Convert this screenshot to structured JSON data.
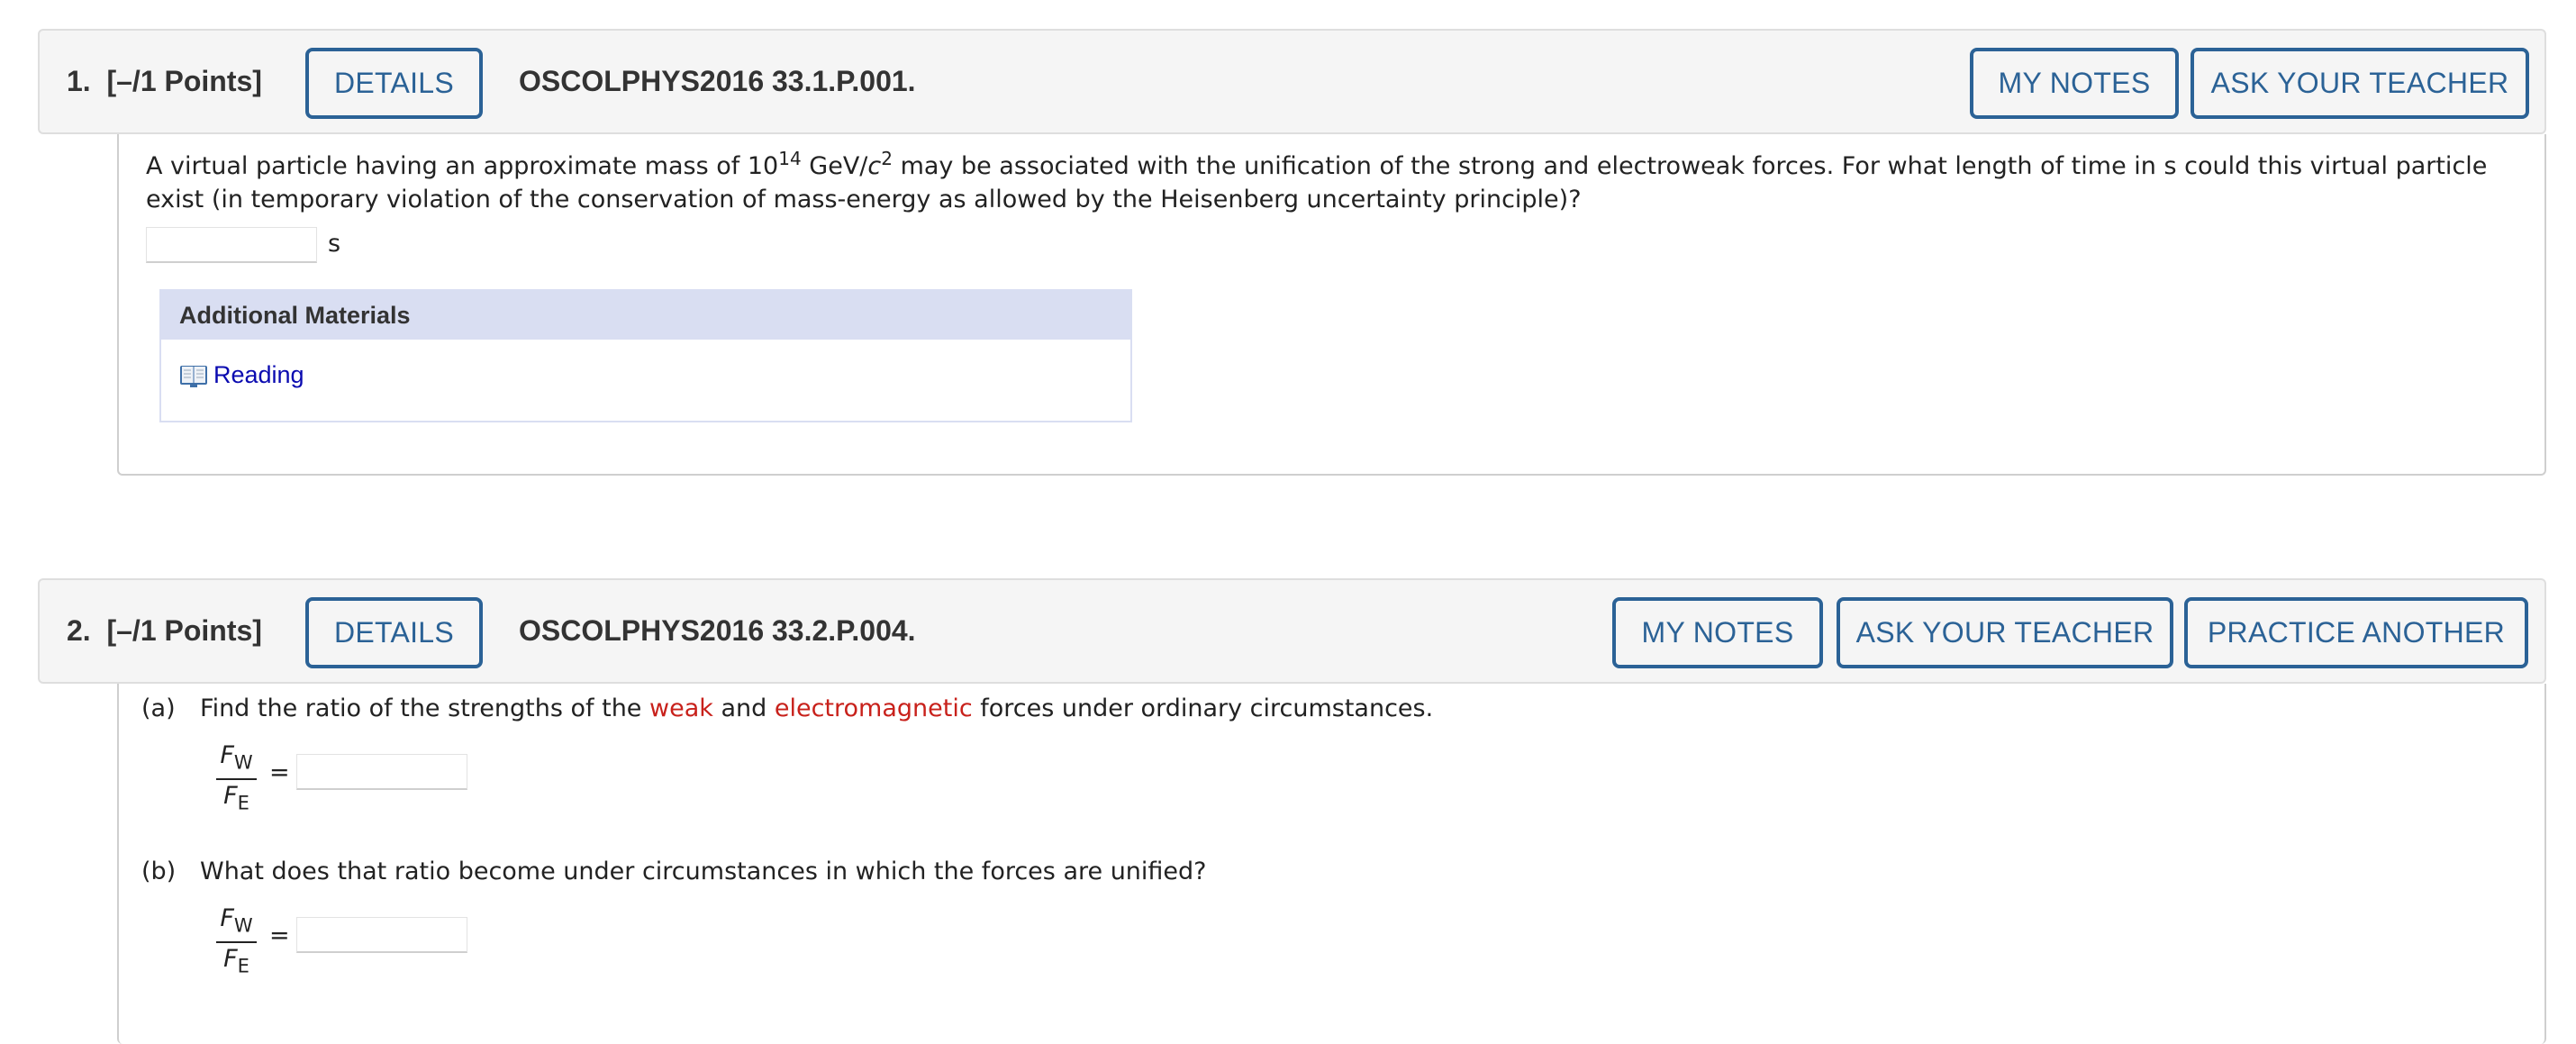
{
  "questions": [
    {
      "number": "1.",
      "points": "[–/1 Points]",
      "details_label": "DETAILS",
      "code": "OSCOLPHYS2016 33.1.P.001.",
      "buttons": [
        "MY NOTES",
        "ASK YOUR TEACHER"
      ],
      "text_before_exp": "A virtual particle having an approximate mass of 10",
      "exp1": "14",
      "text_unit": " GeV/",
      "unit_c": "c",
      "exp2": "2",
      "text_after": " may be associated with the unification of the strong and electroweak forces. For what length of time in s could this virtual particle exist (in temporary violation of the conservation of mass-energy as allowed by the Heisenberg uncertainty principle)?",
      "answer_value": "",
      "answer_unit": "s",
      "additional_materials": {
        "title": "Additional Materials",
        "links": [
          {
            "icon": "book-icon",
            "label": "Reading"
          }
        ]
      }
    },
    {
      "number": "2.",
      "points": "[–/1 Points]",
      "details_label": "DETAILS",
      "code": "OSCOLPHYS2016 33.2.P.004.",
      "buttons": [
        "MY NOTES",
        "ASK YOUR TEACHER",
        "PRACTICE ANOTHER"
      ],
      "parts": [
        {
          "label": "(a)",
          "text_1": "Find the ratio of the strengths of the ",
          "highlight_1": "weak",
          "text_2": " and ",
          "highlight_2": "electromagnetic",
          "text_3": " forces under ordinary circumstances.",
          "numerator": "F",
          "numerator_sub": "W",
          "denominator": "F",
          "denominator_sub": "E",
          "equals": "=",
          "answer_value": ""
        },
        {
          "label": "(b)",
          "text_1": "What does that ratio become under circumstances in which the forces are unified?",
          "numerator": "F",
          "numerator_sub": "W",
          "denominator": "F",
          "denominator_sub": "E",
          "equals": "=",
          "answer_value": ""
        }
      ]
    }
  ],
  "colors": {
    "accent": "#2b6296",
    "highlight": "#c8211b",
    "link": "#0a0ab0",
    "materials_header": "#d9def2"
  }
}
